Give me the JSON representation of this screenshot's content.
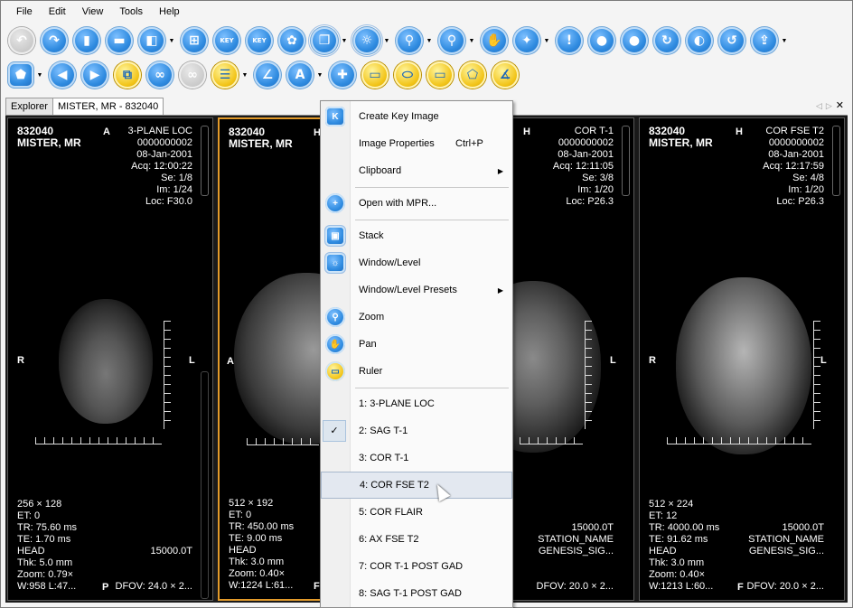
{
  "menu": [
    "File",
    "Edit",
    "View",
    "Tools",
    "Help"
  ],
  "toolbar1": [
    {
      "icon": "back-icon",
      "disabled": true
    },
    {
      "icon": "forward-icon"
    },
    {
      "icon": "clipboard-icon"
    },
    {
      "icon": "layout-rows-icon"
    },
    {
      "icon": "layout-grid-icon",
      "dropdown": true
    },
    {
      "icon": "thumbnail-key-icon"
    },
    {
      "icon": "key-image-icon",
      "text": "KEY"
    },
    {
      "icon": "key-icon",
      "text": "KEY"
    },
    {
      "icon": "film-reel-icon"
    },
    {
      "icon": "stack-icon",
      "dropdown": true,
      "active": true
    },
    {
      "icon": "window-level-icon",
      "dropdown": true,
      "active": true
    },
    {
      "icon": "zoom-icon",
      "dropdown": true
    },
    {
      "icon": "magnifier-icon",
      "dropdown": true
    },
    {
      "icon": "pan-hand-icon"
    },
    {
      "icon": "probe-icon",
      "dropdown": true
    },
    {
      "icon": "info-icon"
    },
    {
      "icon": "group-icon"
    },
    {
      "icon": "users-icon"
    },
    {
      "icon": "users-sync-icon"
    },
    {
      "icon": "invert-icon"
    },
    {
      "icon": "undo-icon"
    },
    {
      "icon": "export-icon",
      "dropdown": true
    }
  ],
  "toolbar2": [
    {
      "icon": "shutter-icon",
      "dropdown": true,
      "square": true
    },
    {
      "icon": "previous-icon"
    },
    {
      "icon": "next-icon"
    },
    {
      "icon": "cine-icon",
      "yellow": true
    },
    {
      "icon": "link-icon"
    },
    {
      "icon": "unlink-icon",
      "disabled": true
    },
    {
      "icon": "mpr-icon",
      "yellow": true,
      "dropdown": true
    },
    {
      "icon": "angle-icon"
    },
    {
      "icon": "text-annotation-icon",
      "text": "A",
      "dropdown": true
    },
    {
      "icon": "crosshair-icon"
    },
    {
      "icon": "ruler-icon",
      "yellow": true
    },
    {
      "icon": "ellipse-icon",
      "yellow": true
    },
    {
      "icon": "rectangle-icon",
      "yellow": true
    },
    {
      "icon": "polygon-icon",
      "yellow": true
    },
    {
      "icon": "protractor-icon",
      "yellow": true
    }
  ],
  "tabs": {
    "explorer": "Explorer",
    "patient": "MISTER, MR - 832040"
  },
  "viewports": [
    {
      "id": "832040",
      "name": "MISTER, MR",
      "orient_top": "A",
      "orient_left": "R",
      "orient_right": "L",
      "orient_bottom": "P",
      "series": "3-PLANE LOC",
      "accession": "0000000002",
      "date": "08-Jan-2001",
      "acq": "Acq: 12:00:22",
      "se": "Se: 1/8",
      "im": "Im: 1/24",
      "loc": "Loc: F30.0",
      "matrix": "256 × 128",
      "et": "ET: 0",
      "tr": "TR: 75.60 ms",
      "te": "TE: 1.70 ms",
      "head": "HEAD",
      "thk": "Thk: 5.0 mm",
      "zoom": "Zoom: 0.79×",
      "wl": "W:958 L:47...",
      "field": "15000.0T",
      "station": "",
      "genesis": "",
      "dfov": "DFOV: 24.0 × 2..."
    },
    {
      "id": "832040",
      "name": "MISTER, MR",
      "orient_top": "H",
      "orient_left": "A",
      "orient_right": "",
      "orient_bottom": "F",
      "series": "",
      "accession": "",
      "date": "",
      "acq": "",
      "se": "",
      "im": "",
      "loc": "",
      "matrix": "512 × 192",
      "et": "ET: 0",
      "tr": "TR: 450.00 ms",
      "te": "TE: 9.00 ms",
      "head": "HEAD",
      "thk": "Thk: 3.0 mm",
      "zoom": "Zoom: 0.40×",
      "wl": "W:1224 L:61...",
      "field": "",
      "station": "",
      "genesis": "",
      "dfov": ""
    },
    {
      "id": "",
      "name": "",
      "orient_top": "H",
      "orient_left": "",
      "orient_right": "L",
      "orient_bottom": "",
      "series": "COR T-1",
      "accession": "0000000002",
      "date": "08-Jan-2001",
      "acq": "Acq: 12:11:05",
      "se": "Se: 3/8",
      "im": "Im: 1/20",
      "loc": "Loc: P26.3",
      "matrix": "",
      "et": "",
      "tr": "",
      "te": "",
      "head": "",
      "thk": "",
      "zoom": "",
      "wl": "",
      "field": "15000.0T",
      "station": "STATION_NAME",
      "genesis": "GENESIS_SIG...",
      "dfov": "DFOV: 20.0 × 2..."
    },
    {
      "id": "832040",
      "name": "MISTER, MR",
      "orient_top": "H",
      "orient_left": "R",
      "orient_right": "L",
      "orient_bottom": "F",
      "series": "COR FSE T2",
      "accession": "0000000002",
      "date": "08-Jan-2001",
      "acq": "Acq: 12:17:59",
      "se": "Se: 4/8",
      "im": "Im: 1/20",
      "loc": "Loc: P26.3",
      "matrix": "512 × 224",
      "et": "ET: 12",
      "tr": "TR: 4000.00 ms",
      "te": "TE: 91.62 ms",
      "head": "HEAD",
      "thk": "Thk: 3.0 mm",
      "zoom": "Zoom: 0.40×",
      "wl": "W:1213 L:60...",
      "field": "15000.0T",
      "station": "STATION_NAME",
      "genesis": "GENESIS_SIG...",
      "dfov": "DFOV: 20.0 × 2..."
    }
  ],
  "context_menu": {
    "create_key_image": "Create Key Image",
    "image_properties": "Image Properties",
    "image_properties_shortcut": "Ctrl+P",
    "clipboard": "Clipboard",
    "open_mpr": "Open with MPR...",
    "stack": "Stack",
    "window_level": "Window/Level",
    "window_level_presets": "Window/Level Presets",
    "zoom": "Zoom",
    "pan": "Pan",
    "ruler": "Ruler",
    "series": [
      "1: 3-PLANE LOC",
      "2: SAG T-1",
      "3: COR T-1",
      "4: COR FSE T2",
      "5: COR FLAIR",
      "6: AX FSE T2",
      "7: COR T-1 POST GAD",
      "8: SAG T-1 POST GAD"
    ],
    "checked_series_index": 1,
    "hovered_series_index": 3
  }
}
